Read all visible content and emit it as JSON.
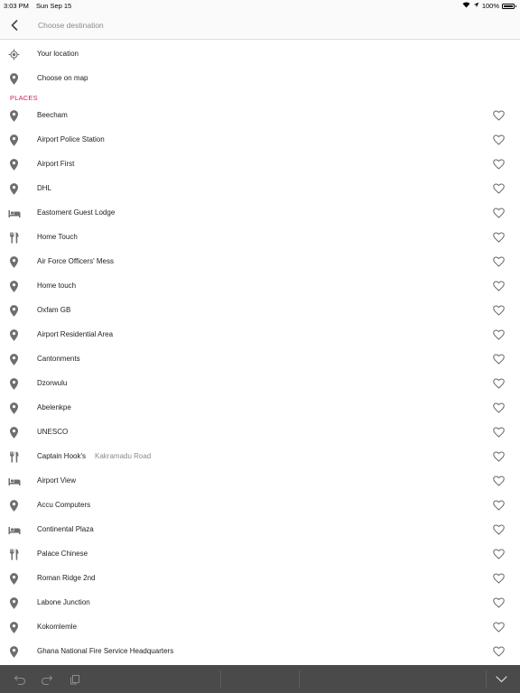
{
  "status_bar": {
    "time": "3:03 PM",
    "date": "Sun Sep 15",
    "battery": "100%"
  },
  "header": {
    "search_placeholder": "Choose destination"
  },
  "options": [
    {
      "label": "Your location",
      "icon": "my-location-icon"
    },
    {
      "label": "Choose on map",
      "icon": "map-pin-icon"
    }
  ],
  "places_header": "PLACES",
  "places": [
    {
      "label": "Beecham",
      "sub": "",
      "icon": "pin"
    },
    {
      "label": "Airport Police Station",
      "sub": "",
      "icon": "pin"
    },
    {
      "label": "Airport First",
      "sub": "",
      "icon": "pin"
    },
    {
      "label": "DHL",
      "sub": "",
      "icon": "pin"
    },
    {
      "label": "Eastoment Guest Lodge",
      "sub": "",
      "icon": "hotel"
    },
    {
      "label": "Home Touch",
      "sub": "",
      "icon": "restaurant"
    },
    {
      "label": "Air Force Officers' Mess",
      "sub": "",
      "icon": "pin"
    },
    {
      "label": "Home touch",
      "sub": "",
      "icon": "pin"
    },
    {
      "label": "Oxfam GB",
      "sub": "",
      "icon": "pin"
    },
    {
      "label": "Airport Residential Area",
      "sub": "",
      "icon": "pin"
    },
    {
      "label": "Cantonments",
      "sub": "",
      "icon": "pin"
    },
    {
      "label": "Dzorwulu",
      "sub": "",
      "icon": "pin"
    },
    {
      "label": "Abelenkpe",
      "sub": "",
      "icon": "pin"
    },
    {
      "label": "UNESCO",
      "sub": "",
      "icon": "pin"
    },
    {
      "label": "Captain Hook's",
      "sub": "Kakramadu Road",
      "icon": "restaurant"
    },
    {
      "label": "Airport View",
      "sub": "",
      "icon": "hotel"
    },
    {
      "label": "Accu Computers",
      "sub": "",
      "icon": "pin"
    },
    {
      "label": "Continental Plaza",
      "sub": "",
      "icon": "hotel"
    },
    {
      "label": "Palace Chinese",
      "sub": "",
      "icon": "restaurant"
    },
    {
      "label": "Roman Ridge 2nd",
      "sub": "",
      "icon": "pin"
    },
    {
      "label": "Labone Junction",
      "sub": "",
      "icon": "pin"
    },
    {
      "label": "Kokomlemle",
      "sub": "",
      "icon": "pin"
    },
    {
      "label": "Ghana National Fire Service Headquarters",
      "sub": "",
      "icon": "pin"
    }
  ],
  "colors": {
    "accent": "#d81b60",
    "icon": "#6e6e6e",
    "toolbar": "#4a4a4a"
  }
}
